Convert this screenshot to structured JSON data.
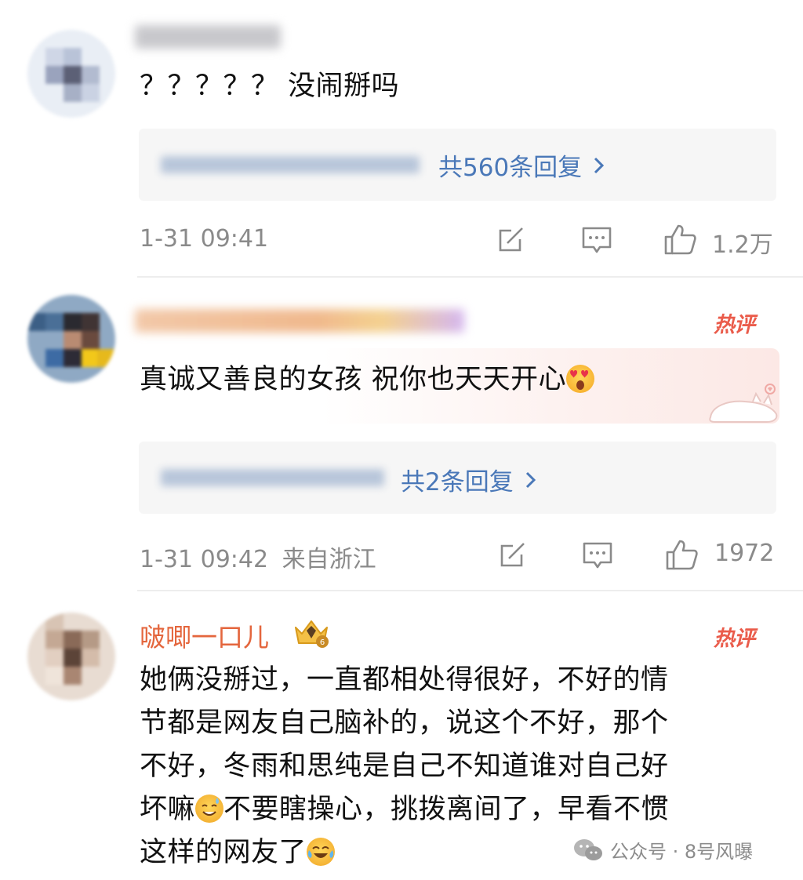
{
  "comments": [
    {
      "text": "？？？？？ 没闹掰吗",
      "reply_label": "共560条回复",
      "timestamp": "1-31 09:41",
      "location": "",
      "likes": "1.2万",
      "hot": ""
    },
    {
      "text": "真诚又善良的女孩 祝你也天天开心",
      "reply_label": "共2条回复",
      "timestamp": "1-31 09:42",
      "location": "来自浙江",
      "likes": "1972",
      "hot": "热评"
    },
    {
      "username": "啵唧一口儿",
      "text_lines": [
        "她俩没掰过，一直都相处得很好，不好的情",
        "节都是网友自己脑补的，说这个不好，那个",
        "不好，冬雨和思纯是自己不知道谁对自己好",
        "坏嘛",
        "这样的网友了"
      ],
      "line4_rest": "不要瞎操心，挑拨离间了，早看不惯",
      "hot": "热评"
    }
  ],
  "icons": {
    "share": "share-icon",
    "comment": "comment-icon",
    "like": "thumbs-up-icon",
    "chevron": "chevron-right-icon"
  },
  "watermark": {
    "text": "公众号 · 8号风曝"
  },
  "colors": {
    "link": "#4a78b8",
    "username": "#e4663d",
    "hot": "#ea5c4b",
    "meta": "#8a8a8a"
  }
}
